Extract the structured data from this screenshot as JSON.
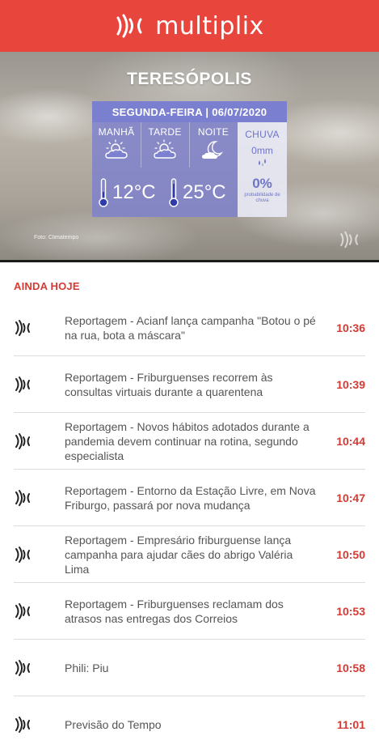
{
  "header": {
    "logo_text": "multiplix",
    "logo_icon": "sound-waves-icon",
    "background": "#e8453c"
  },
  "weather": {
    "city": "TERESÓPOLIS",
    "date_label": "SEGUNDA-FEIRA | 06/07/2020",
    "periods": [
      {
        "label": "MANHÃ",
        "icon": "partly-cloudy-sun-icon"
      },
      {
        "label": "TARDE",
        "icon": "partly-cloudy-sun-icon"
      },
      {
        "label": "NOITE",
        "icon": "moon-cloud-icon"
      }
    ],
    "min_temp": "12°C",
    "max_temp": "25°C",
    "rain": {
      "label": "CHUVA",
      "amount": "0mm",
      "probability": "0%",
      "probability_caption": "probabilidade de chuva"
    },
    "photo_credit": "Foto: Climatempo"
  },
  "section": {
    "title": "AINDA HOJE"
  },
  "schedule": [
    {
      "title": "Reportagem - Acianf lança campanha \"Botou o pé na rua, bota a máscara\"",
      "time": "10:36"
    },
    {
      "title": "Reportagem - Friburguenses recorrem às consultas virtuais durante a quarentena",
      "time": "10:39"
    },
    {
      "title": "Reportagem - Novos hábitos adotados durante a pandemia devem continuar na rotina, segundo especialista",
      "time": "10:44"
    },
    {
      "title": "Reportagem - Entorno da Estação Livre, em Nova Friburgo, passará por nova mudança",
      "time": "10:47"
    },
    {
      "title": "Reportagem - Empresário friburguense lança campanha para ajudar cães do abrigo Valéria Lima",
      "time": "10:50"
    },
    {
      "title": "Reportagem - Friburguenses reclamam dos atrasos nas entregas dos Correios",
      "time": "10:53"
    },
    {
      "title": "Phili: Piu",
      "time": "10:58"
    },
    {
      "title": "Previsão do Tempo",
      "time": "11:01"
    }
  ],
  "colors": {
    "accent": "#d63a33",
    "weather_panel": "#7b7fd0"
  }
}
